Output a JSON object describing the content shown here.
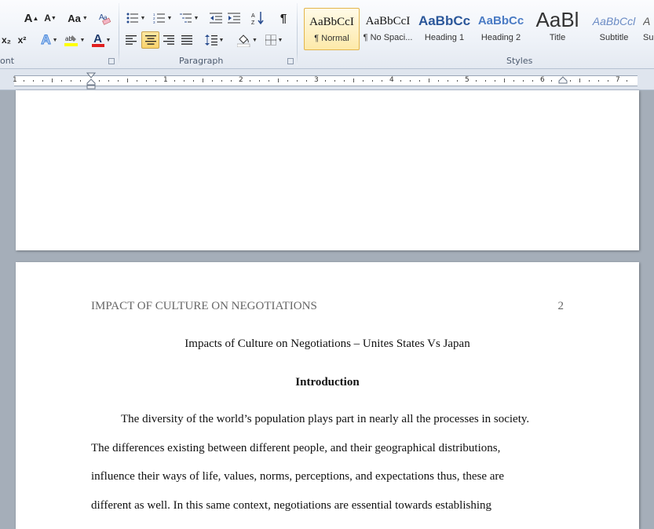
{
  "ribbon": {
    "groups": {
      "font_label": "ont",
      "paragraph_label": "Paragraph",
      "styles_label": "Styles"
    },
    "font": {
      "grow_glyph": "A",
      "shrink_glyph": "A",
      "case_label": "Aa",
      "subscript_label": "x₂",
      "superscript_label": "x²",
      "font_color_letter": "A",
      "highlight_color": "#ffff00",
      "font_color": "#e02020"
    },
    "paragraph": {
      "show_marks_glyph": "¶"
    },
    "styles": [
      {
        "sample": "AaBbCcI",
        "name": "¶ Normal",
        "selected": true
      },
      {
        "sample": "AaBbCcI",
        "name": "¶ No Spaci..."
      },
      {
        "sample": "AaBbCc",
        "name": "Heading 1"
      },
      {
        "sample": "AaBbCc",
        "name": "Heading 2"
      },
      {
        "sample": "AaBl",
        "name": "Title"
      },
      {
        "sample": "AaBbCcl",
        "name": "Subtitle"
      },
      {
        "sample": "A",
        "name": "Su"
      }
    ]
  },
  "ruler": {
    "numbers": [
      "1",
      "1",
      "2",
      "3",
      "4",
      "5",
      "6",
      "7"
    ]
  },
  "document": {
    "header_title": "IMPACT OF CULTURE ON NEGOTIATIONS",
    "page_number": "2",
    "title": "Impacts of Culture on Negotiations – Unites States Vs Japan",
    "heading": "Introduction",
    "paragraph_lines": [
      "The diversity of the world’s population plays part in nearly all the processes in society.",
      "The differences existing between different people, and their geographical distributions,",
      "influence their ways of life, values, norms, perceptions, and expectations thus, these are",
      "different as well. In this same context, negotiations are essential towards establishing"
    ]
  },
  "colors": {
    "selected_button": "#f9d36c",
    "app_background": "#a5aeb9",
    "heading_blue": "#2b579a"
  }
}
